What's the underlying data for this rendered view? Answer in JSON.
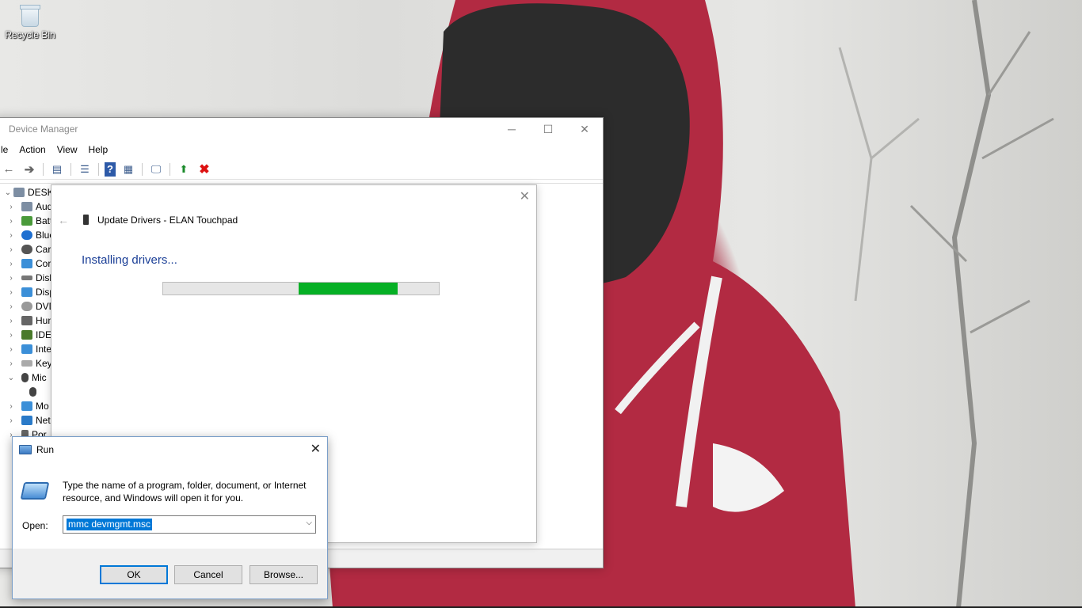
{
  "desktop": {
    "icons": [
      {
        "label": "Recycle Bin",
        "icon": "recycle-bin-icon"
      }
    ]
  },
  "device_manager": {
    "title": "Device Manager",
    "window_controls": {
      "minimize": "─",
      "maximize": "☐",
      "close": "✕"
    },
    "menu": [
      "le",
      "Action",
      "View",
      "Help"
    ],
    "toolbar_icons": [
      "back-icon",
      "forward-icon",
      "properties-icon",
      "show-hide-icon",
      "help-icon",
      "view-icon",
      "scan-hardware-icon",
      "update-driver-icon",
      "uninstall-icon"
    ],
    "tree": [
      {
        "label": "DESKTO",
        "expanded": true,
        "icon": "computer-icon"
      },
      {
        "label": "Aud",
        "icon": "audio-icon"
      },
      {
        "label": "Batt",
        "icon": "battery-icon"
      },
      {
        "label": "Blue",
        "icon": "bluetooth-icon"
      },
      {
        "label": "Car",
        "icon": "camera-icon"
      },
      {
        "label": "Cor",
        "icon": "computer-icon"
      },
      {
        "label": "Disk",
        "icon": "disk-icon"
      },
      {
        "label": "Disp",
        "icon": "display-icon"
      },
      {
        "label": "DVD",
        "icon": "dvd-icon"
      },
      {
        "label": "Hun",
        "icon": "hid-icon"
      },
      {
        "label": "IDE",
        "icon": "ide-icon"
      },
      {
        "label": "Inte",
        "icon": "interface-icon"
      },
      {
        "label": "Key",
        "icon": "keyboard-icon"
      },
      {
        "label": "Mic",
        "expanded": true,
        "icon": "mouse-icon"
      },
      {
        "label": "",
        "icon": "mouse-icon",
        "child": true
      },
      {
        "label": "Mo",
        "icon": "monitor-icon"
      },
      {
        "label": "Net",
        "icon": "network-icon"
      },
      {
        "label": "Por",
        "icon": "port-icon"
      }
    ]
  },
  "update_drivers": {
    "close": "✕",
    "back": "←",
    "breadcrumb": "Update Drivers - ELAN Touchpad",
    "heading": "Installing drivers...",
    "progress": {
      "start": 0.49,
      "end": 0.85,
      "color": "#06b025"
    }
  },
  "run_dialog": {
    "title": "Run",
    "close": "✕",
    "description": "Type the name of a program, folder, document, or Internet resource, and Windows will open it for you.",
    "open_label": "Open:",
    "open_value": "mmc devmgmt.msc",
    "buttons": {
      "ok": "OK",
      "cancel": "Cancel",
      "browse": "Browse..."
    }
  },
  "colors": {
    "accent": "#0078d7",
    "heading_blue": "#1a3e96",
    "progress_green": "#06b025",
    "hoodie_red": "#b8263f"
  }
}
